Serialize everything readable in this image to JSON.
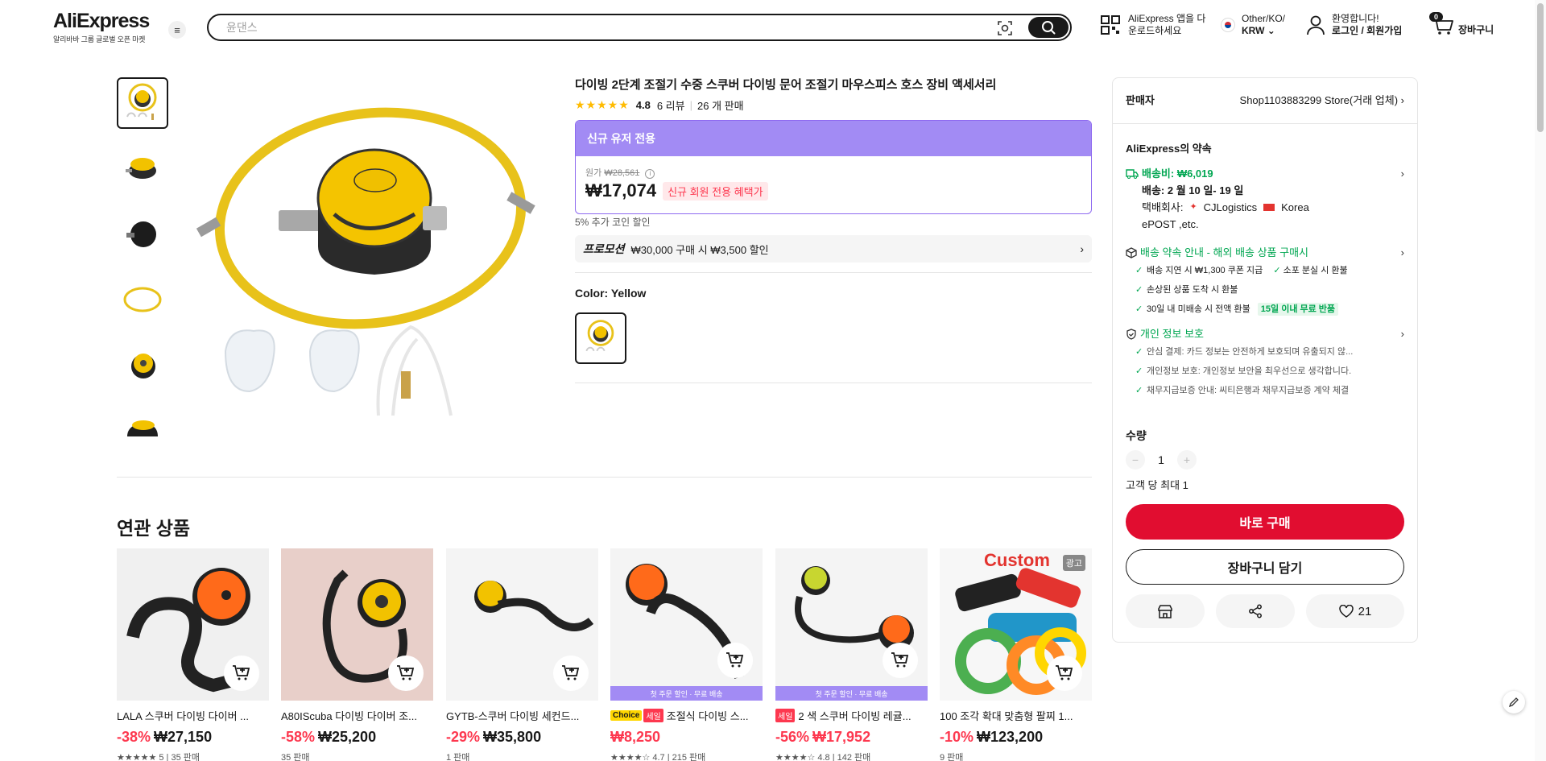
{
  "header": {
    "logo": "AliExpress",
    "logo_sub": "알리바바 그룹 글로벌 오픈 마켓",
    "search_placeholder": "윤댄스",
    "app_line1": "AliExpress 앱을 다",
    "app_line2": "운로드하세요",
    "locale_line1": "Other/KO/",
    "locale_line2": "KRW",
    "account_line1": "환영합니다!",
    "account_line2": "로그인 / 회원가입",
    "cart_count": "0",
    "cart_label": "장바구니"
  },
  "product": {
    "title": "다이빙 2단계 조절기 수중 스쿠버 다이빙 문어 조절기 마우스피스 호스 장비 액세서리",
    "rating": "4.8",
    "reviews": "6 리뷰",
    "sold": "26 개 판매",
    "promo_header": "신규 유저 전용",
    "orig_label": "원가",
    "orig_price": "₩28,561",
    "price": "₩17,074",
    "price_tag": "신규 회원 전용 혜택가",
    "coin_note": "5% 추가 코인 할인",
    "promo_label": "프로모션",
    "promo_text": "₩30,000 구매 시 ₩3,500 할인",
    "color_label": "Color: Yellow"
  },
  "related": {
    "title": "연관 상품",
    "items": [
      {
        "name": "LALA 스쿠버 다이빙 다이버 ...",
        "discount": "-38%",
        "price": "₩27,150",
        "meta": "★★★★★ 5 | 35 판매",
        "band": "",
        "choice": "",
        "sale": "",
        "ad": ""
      },
      {
        "name": "A80IScuba 다이빙 다이버 조...",
        "discount": "-58%",
        "price": "₩25,200",
        "meta": "35 판매",
        "band": "",
        "choice": "",
        "sale": "",
        "ad": ""
      },
      {
        "name": "GYTB-스쿠버 다이빙 세컨드...",
        "discount": "-29%",
        "price": "₩35,800",
        "meta": "1 판매",
        "band": "",
        "choice": "",
        "sale": "",
        "ad": ""
      },
      {
        "name": "조절식 다이빙 스...",
        "discount": "",
        "price": "₩8,250",
        "meta": "★★★★☆ 4.7 | 215 판매",
        "band": "첫 주문 할인 · 무료 배송",
        "choice": "Choice",
        "sale": "세일",
        "ad": ""
      },
      {
        "name": "2 색 스쿠버 다이빙 레귤...",
        "discount": "-56%",
        "price": "₩17,952",
        "meta": "★★★★☆ 4.8 | 142 판매",
        "band": "첫 주문 할인 · 무료 배송",
        "choice": "",
        "sale": "세일",
        "ad": ""
      },
      {
        "name": "100 조각 확대 맞춤형 팔찌 1...",
        "discount": "-10%",
        "price": "₩123,200",
        "meta": "9 판매",
        "band": "",
        "choice": "",
        "sale": "",
        "ad": "광고"
      }
    ]
  },
  "panel": {
    "seller_label": "판매자",
    "seller_name": "Shop1103883299 Store(거래 업체)",
    "promise_title": "AliExpress의 약속",
    "ship_fee": "배송비: ₩6,019",
    "ship_date": "배송: 2 월 10 일- 19 일",
    "carrier_label": "택배회사:",
    "carrier1": "CJLogistics",
    "carrier2": "Korea",
    "carrier3": "ePOST ,etc.",
    "guarantee_title": "배송 약속 안내 - 해외 배송 상품 구매시",
    "g1": "배송 지연 시 ₩1,300 쿠폰 지급",
    "g2": "소포 분실 시 환불",
    "g3": "손상된 상품 도착 시 환불",
    "g4": "30일 내 미배송 시 전액 환불",
    "g4_tag": "15일 이내 무료 반품",
    "privacy_title": "개인 정보 보호",
    "p1": "안심 결제: 카드 정보는 안전하게 보호되며 유출되지 않...",
    "p2": "개인정보 보호: 개인정보 보안을 최우선으로 생각합니다.",
    "p3": "채무지급보증 안내: 씨티은행과 채무지급보증 계약 체결",
    "qty_label": "수량",
    "qty_minus": "−",
    "qty_value": "1",
    "qty_plus": "+",
    "max_line": "고객 당 최대 1",
    "buy_now": "바로 구매",
    "add_cart": "장바구니 담기",
    "wish_count": "21"
  },
  "colors": {
    "accent_red": "#e10d30",
    "promo_purple": "#a28bf4",
    "green": "#00a651"
  }
}
